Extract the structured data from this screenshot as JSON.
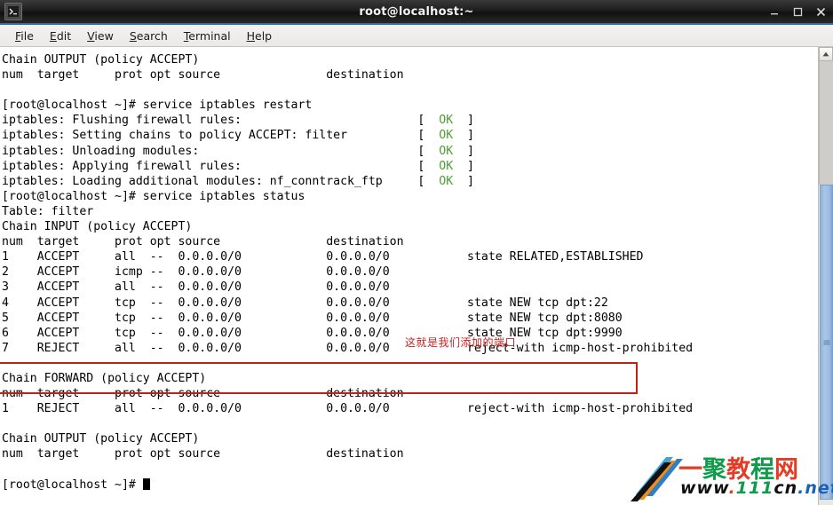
{
  "window": {
    "title": "root@localhost:~",
    "icon": "terminal-icon",
    "minimize_label": "–",
    "maximize_label": "□",
    "close_label": "✕"
  },
  "menubar": {
    "items": [
      {
        "mnemonic": "F",
        "rest": "ile",
        "name": "file"
      },
      {
        "mnemonic": "E",
        "rest": "dit",
        "name": "edit"
      },
      {
        "mnemonic": "V",
        "rest": "iew",
        "name": "view"
      },
      {
        "mnemonic": "S",
        "rest": "earch",
        "name": "search"
      },
      {
        "mnemonic": "T",
        "rest": "erminal",
        "name": "terminal"
      },
      {
        "mnemonic": "H",
        "rest": "elp",
        "name": "help"
      }
    ]
  },
  "terminal": {
    "lines": [
      "Chain OUTPUT (policy ACCEPT)",
      "num  target     prot opt source               destination",
      "",
      "[root@localhost ~]# service iptables restart",
      "iptables: Flushing firewall rules:                         [  OK  ]",
      "iptables: Setting chains to policy ACCEPT: filter          [  OK  ]",
      "iptables: Unloading modules:                               [  OK  ]",
      "iptables: Applying firewall rules:                         [  OK  ]",
      "iptables: Loading additional modules: nf_conntrack_ftp     [  OK  ]",
      "[root@localhost ~]# service iptables status",
      "Table: filter",
      "Chain INPUT (policy ACCEPT)",
      "num  target     prot opt source               destination",
      "1    ACCEPT     all  --  0.0.0.0/0            0.0.0.0/0           state RELATED,ESTABLISHED",
      "2    ACCEPT     icmp --  0.0.0.0/0            0.0.0.0/0",
      "3    ACCEPT     all  --  0.0.0.0/0            0.0.0.0/0",
      "4    ACCEPT     tcp  --  0.0.0.0/0            0.0.0.0/0           state NEW tcp dpt:22",
      "5    ACCEPT     tcp  --  0.0.0.0/0            0.0.0.0/0           state NEW tcp dpt:8080",
      "6    ACCEPT     tcp  --  0.0.0.0/0            0.0.0.0/0           state NEW tcp dpt:9990",
      "7    REJECT     all  --  0.0.0.0/0            0.0.0.0/0           reject-with icmp-host-prohibited",
      "",
      "Chain FORWARD (policy ACCEPT)",
      "num  target     prot opt source               destination",
      "1    REJECT     all  --  0.0.0.0/0            0.0.0.0/0           reject-with icmp-host-prohibited",
      "",
      "Chain OUTPUT (policy ACCEPT)",
      "num  target     prot opt source               destination",
      "",
      "[root@localhost ~]# "
    ],
    "ok_token": "OK",
    "ok_color": "#4aa033",
    "prompt": "[root@localhost ~]#"
  },
  "annotation": {
    "text": "这就是我们添加的端口",
    "color": "#cc2222",
    "box_color": "#c02018"
  },
  "scrollbar": {
    "up_arrow": "▲"
  },
  "watermark": {
    "cn_chars": [
      "一",
      "聚",
      "教",
      "程",
      "网"
    ],
    "url_parts": [
      "www",
      ".",
      "111",
      "cn",
      ".net"
    ],
    "stripe_colors": [
      "#3aa5dc",
      "#2f7fc4",
      "#ef8c1f",
      "#111111"
    ]
  }
}
